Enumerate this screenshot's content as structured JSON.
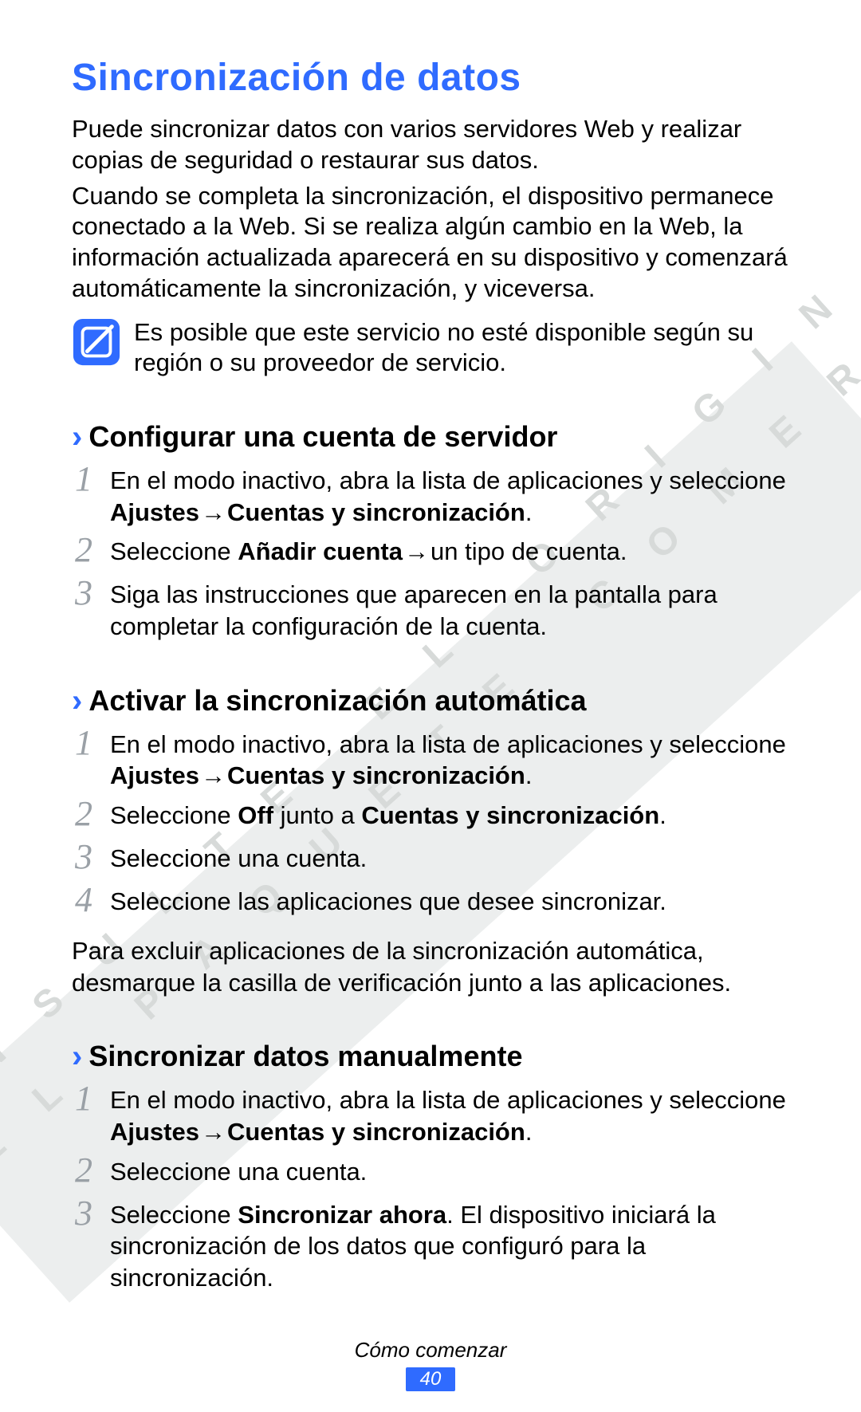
{
  "watermark": {
    "line1": "C O N S U L T E   E L   O R I G I N A L",
    "line2": "E N   E L   P A Q U E T E   C O M E R C I A L"
  },
  "title": "Sincronización de datos",
  "intro1": "Puede sincronizar datos con varios servidores Web y realizar copias de seguridad o restaurar sus datos.",
  "intro2": "Cuando se completa la sincronización, el dispositivo permanece conectado a la Web. Si se realiza algún cambio en la Web, la información actualizada aparecerá en su dispositivo y comenzará automáticamente la sincronización, y viceversa.",
  "note": "Es posible que este servicio no esté disponible según su región o su proveedor de servicio.",
  "sections": {
    "a": {
      "title": "Configurar una cuenta de servidor",
      "steps": {
        "s1": {
          "num": "1",
          "pre": "En el modo inactivo, abra la lista de aplicaciones y seleccione ",
          "b1": "Ajustes",
          "arrow": " → ",
          "b2": "Cuentas y sincronización",
          "post": "."
        },
        "s2": {
          "num": "2",
          "pre": "Seleccione ",
          "b1": "Añadir cuenta",
          "arrow": " → ",
          "post": "un tipo de cuenta."
        },
        "s3": {
          "num": "3",
          "text": "Siga las instrucciones que aparecen en la pantalla para completar la configuración de la cuenta."
        }
      }
    },
    "b": {
      "title": "Activar la sincronización automática",
      "steps": {
        "s1": {
          "num": "1",
          "pre": "En el modo inactivo, abra la lista de aplicaciones y seleccione ",
          "b1": "Ajustes",
          "arrow": " → ",
          "b2": "Cuentas y sincronización",
          "post": "."
        },
        "s2": {
          "num": "2",
          "pre": "Seleccione ",
          "b1": "Off",
          "mid": " junto a ",
          "b2": "Cuentas y sincronización",
          "post": "."
        },
        "s3": {
          "num": "3",
          "text": "Seleccione una cuenta."
        },
        "s4": {
          "num": "4",
          "text": "Seleccione las aplicaciones que desee sincronizar."
        }
      },
      "after": "Para excluir aplicaciones de la sincronización automática, desmarque la casilla de verificación junto a las aplicaciones."
    },
    "c": {
      "title": "Sincronizar datos manualmente",
      "steps": {
        "s1": {
          "num": "1",
          "pre": "En el modo inactivo, abra la lista de aplicaciones y seleccione ",
          "b1": "Ajustes",
          "arrow": " → ",
          "b2": "Cuentas y sincronización",
          "post": "."
        },
        "s2": {
          "num": "2",
          "text": "Seleccione una cuenta."
        },
        "s3": {
          "num": "3",
          "pre": "Seleccione ",
          "b1": "Sincronizar ahora",
          "post": ". El dispositivo iniciará la sincronización de los datos que configuró para la sincronización."
        }
      }
    }
  },
  "footer": {
    "section": "Cómo comenzar",
    "page": "40"
  }
}
